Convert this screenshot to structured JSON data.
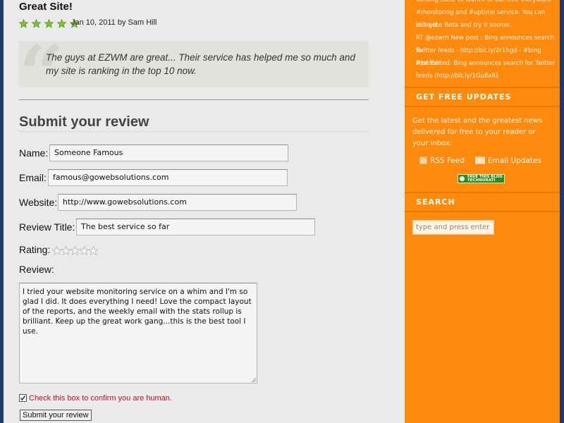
{
  "review": {
    "title": "Great Site!",
    "rating": 5,
    "meta": "Jan 10, 2011 by Sam Hill",
    "quote": "The guys at EZWM are great... Their service has helped me so much and my site is ranking in the top 10 now."
  },
  "form": {
    "heading": "Submit your review",
    "name_label": "Name:",
    "name_value": "Someone Famous",
    "email_label": "Email:",
    "email_value": "famous@gowebsolutions.com",
    "website_label": "Website:",
    "website_value": "http://www.gowebsolutions.com",
    "review_title_label": "Review Title:",
    "review_title_value": "The best service so far",
    "rating_label": "Rating:",
    "rating_value": 0,
    "review_label": "Review:",
    "review_text": "I tried your website monitoring service on a whim and I'm so glad I did. It does everything I need! Love the compact layout of the reports, and the weekly email with the stats rollup is brilliant. Keep up the great work gang...this is the best tool I use.",
    "human_check_label": "Check this box to confirm you are human.",
    "human_checked": true,
    "submit_label": "Submit your review"
  },
  "sidebar": {
    "tweets": [
      "Getting close to launch of our free #keyword",
      "#monitoring and #uptime service. You can still get",
      "in on the Beta and try it sooner.",
      "RT @ezwm New post : Bing announces search for",
      "Twitter feeds - http://bit.ly/2r1hgd - #bing #twitter",
      "Post Edited: Bing announces search for Twitter",
      "feeds (http://bit.ly/1Gu8xR)"
    ],
    "updates_heading": "GET FREE UPDATES",
    "updates_text": "Get the latest and the greatest news delivered for free to your reader or your inbox:",
    "rss_label": "RSS Feed",
    "email_updates_label": "Email Updates",
    "badge_text": "FAVE THIS BLOG TECHNORATI",
    "search_heading": "SEARCH",
    "search_placeholder": "type and press enter"
  },
  "colors": {
    "sidebar_bg": "#fd8a0d",
    "main_bg": "#eaeaea",
    "frame": "#1c3a6b",
    "star_green": "#7cc32c",
    "confirm_red": "#c0141c"
  },
  "icons": [
    "star-icon",
    "quote-mark-icon",
    "rss-icon",
    "email-icon",
    "technorati-icon",
    "resize-grip-icon"
  ]
}
